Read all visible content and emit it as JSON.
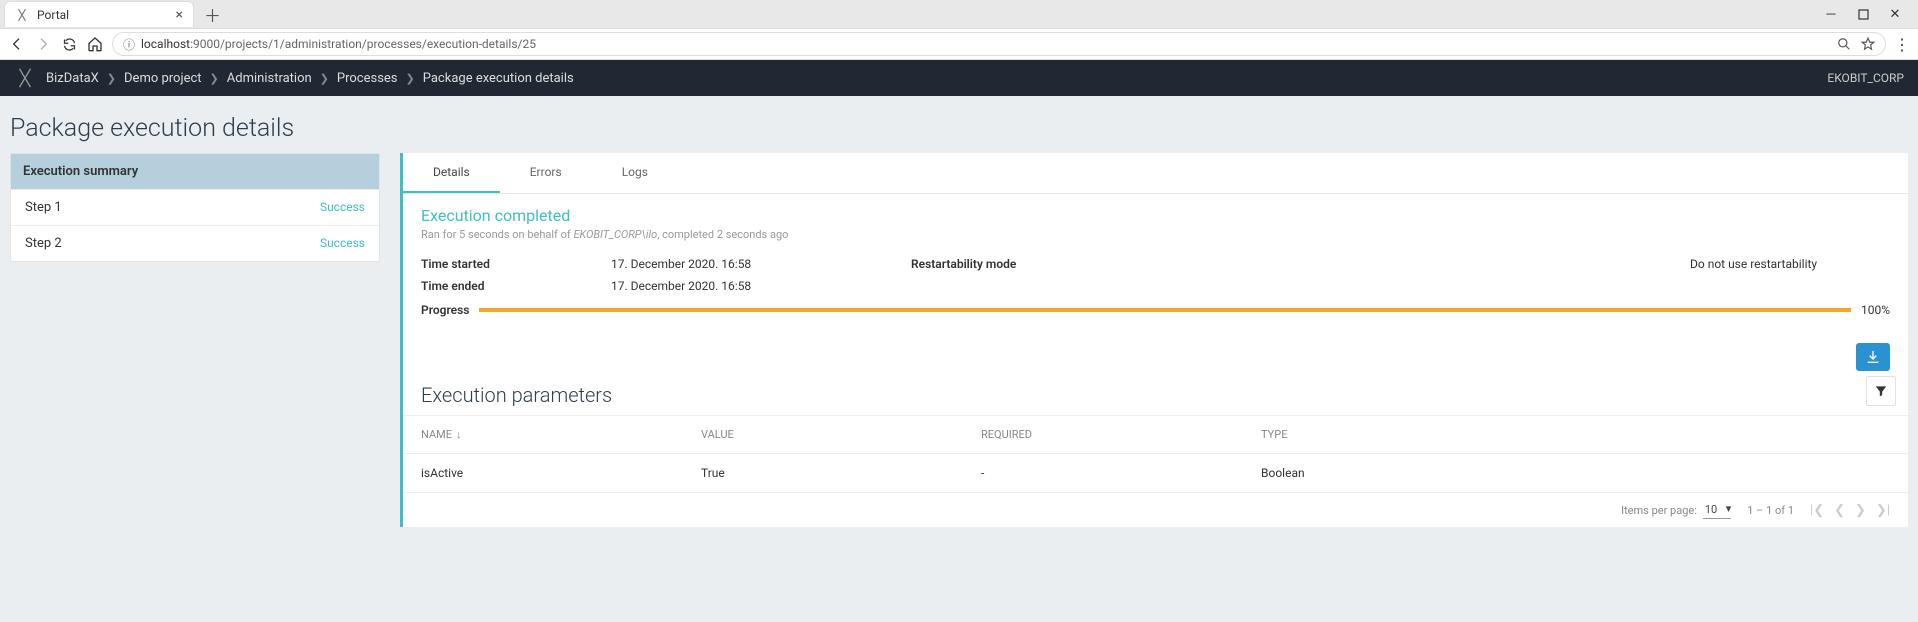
{
  "browser": {
    "tab_title": "Portal",
    "url_host": "localhost",
    "url_path": ":9000/projects/1/administration/processes/execution-details/25"
  },
  "appbar": {
    "breadcrumb": [
      "BizDataX",
      "Demo project",
      "Administration",
      "Processes",
      "Package execution details"
    ],
    "user": "EKOBIT_CORP"
  },
  "page_title": "Package execution details",
  "summary": {
    "header": "Execution summary",
    "items": [
      {
        "label": "Step 1",
        "status": "Success"
      },
      {
        "label": "Step 2",
        "status": "Success"
      }
    ]
  },
  "tabs": {
    "details": "Details",
    "errors": "Errors",
    "logs": "Logs"
  },
  "execution": {
    "status_title": "Execution completed",
    "subtitle_ran": "Ran for 5 seconds on behalf of ",
    "subtitle_user": "EKOBIT_CORP\\ilo",
    "subtitle_completed": ", completed 2 seconds ago",
    "time_started_label": "Time started",
    "time_started_value": "17. December 2020. 16:58",
    "time_ended_label": "Time ended",
    "time_ended_value": "17. December 2020. 16:58",
    "restart_mode_label": "Restartability mode",
    "restart_mode_value": "Do not use restartability",
    "progress_label": "Progress",
    "progress_pct": 100,
    "progress_text": "100%"
  },
  "params": {
    "heading": "Execution parameters",
    "columns": {
      "name": "NAME",
      "value": "VALUE",
      "required": "REQUIRED",
      "type": "TYPE"
    },
    "rows": [
      {
        "name": "isActive",
        "value": "True",
        "required": "-",
        "type": "Boolean"
      }
    ],
    "paginator": {
      "items_per_page_label": "Items per page:",
      "items_per_page_value": "10",
      "range_text": "1 – 1 of 1"
    }
  }
}
